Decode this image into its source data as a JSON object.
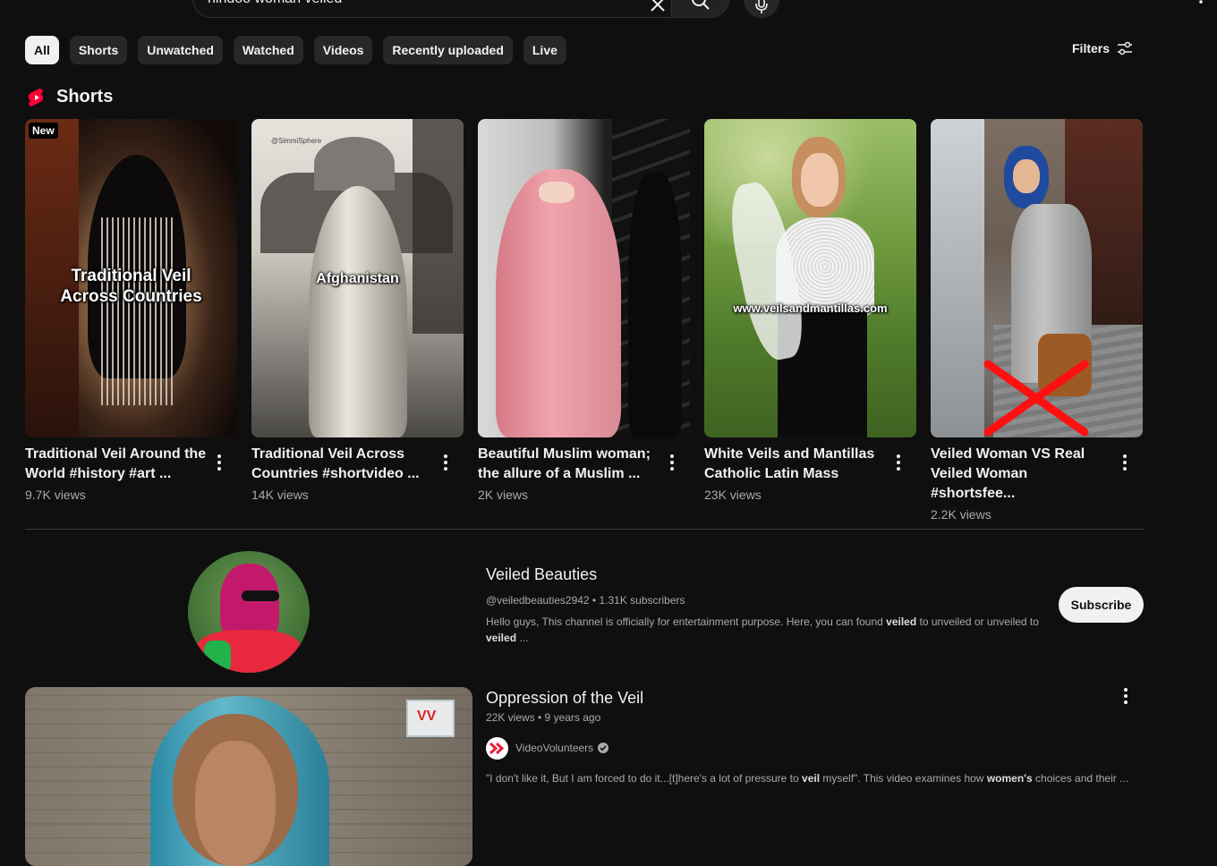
{
  "search": {
    "query": "hindoo woman veiled"
  },
  "chips": [
    "All",
    "Shorts",
    "Unwatched",
    "Watched",
    "Videos",
    "Recently uploaded",
    "Live"
  ],
  "filters_label": "Filters",
  "shorts_section": {
    "title": "Shorts",
    "items": [
      {
        "badge": "New",
        "overlay": "Traditional Veil Across Countries",
        "title": "Traditional Veil Around the World #history #art ...",
        "views": "9.7K views"
      },
      {
        "watermark": "@SimmiSphere",
        "overlay": "Afghanistan",
        "title": "Traditional Veil Across Countries #shortvideo ...",
        "views": "14K views"
      },
      {
        "title": "Beautiful Muslim woman; the allure of a Muslim ...",
        "views": "2K views"
      },
      {
        "overlay": "www.veilsandmantillas.com",
        "title": "White Veils and Mantillas Catholic Latin Mass",
        "views": "23K views"
      },
      {
        "title": "Veiled Woman VS  Real Veiled Woman #shortsfee...",
        "views": "2.2K views"
      }
    ]
  },
  "channel": {
    "name": "Veiled Beauties",
    "handle_subs": "@veiledbeauties2942 • 1.31K subscribers",
    "desc_a": "Hello guys, This channel is officially for entertainment purpose. Here, you can found ",
    "desc_b": "veiled",
    "desc_c": " to unveiled or unveiled to ",
    "desc_d": "veiled",
    "desc_e": " ...",
    "subscribe_label": "Subscribe"
  },
  "video": {
    "title": "Oppression of the Veil",
    "meta": "22K views • 9 years ago",
    "channel_name": "VideoVolunteers",
    "thumb_logo": "VV",
    "desc_a": "\"I don't like it, But I am forced to do it...[t]here's a lot of pressure to ",
    "desc_b": "veil",
    "desc_c": " myself\". This video examines how ",
    "desc_d": "women's",
    "desc_e": " choices and their ..."
  }
}
